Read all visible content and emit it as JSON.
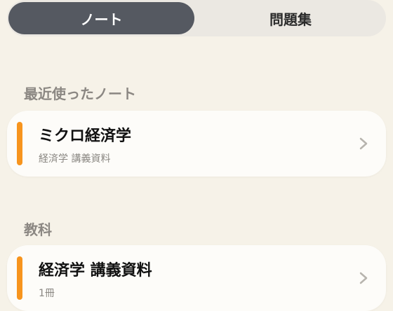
{
  "tabs": [
    {
      "label": "ノート",
      "active": true
    },
    {
      "label": "問題集",
      "active": false
    }
  ],
  "recent": {
    "title": "最近使ったノート",
    "card": {
      "title": "ミクロ経済学",
      "subtitle": "経済学 講義資料"
    }
  },
  "subjects": {
    "title": "教科",
    "card": {
      "title": "経済学 講義資料",
      "subtitle": "1冊"
    }
  },
  "colors": {
    "accent": "#f7941d",
    "active_tab": "#555961",
    "background": "#f6f2e8"
  },
  "icons": {
    "chevron": "chevron-right-icon"
  }
}
